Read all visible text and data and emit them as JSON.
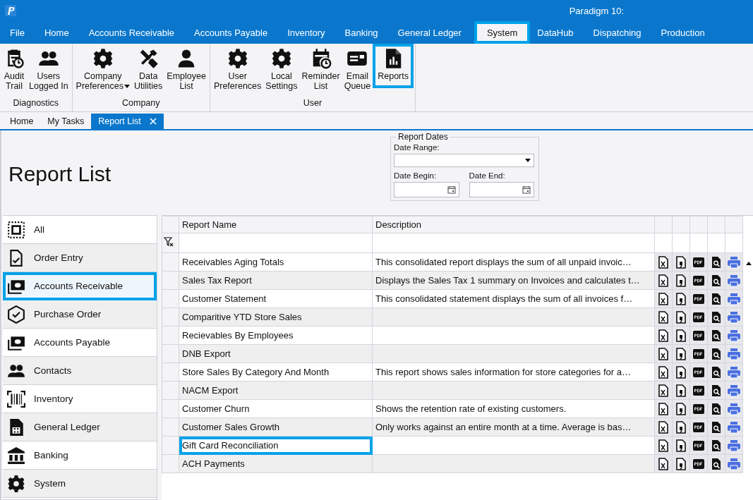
{
  "window": {
    "title": "Paradigm 10:"
  },
  "menu": [
    {
      "label": "File",
      "selected": false
    },
    {
      "label": "Home",
      "selected": false
    },
    {
      "label": "Accounts Receivable",
      "selected": false
    },
    {
      "label": "Accounts Payable",
      "selected": false
    },
    {
      "label": "Inventory",
      "selected": false
    },
    {
      "label": "Banking",
      "selected": false
    },
    {
      "label": "General Ledger",
      "selected": false
    },
    {
      "label": "System",
      "selected": true
    },
    {
      "label": "DataHub",
      "selected": false
    },
    {
      "label": "Dispatching",
      "selected": false
    },
    {
      "label": "Production",
      "selected": false
    }
  ],
  "ribbon": [
    {
      "group": "Diagnostics",
      "buttons": [
        {
          "lines": [
            "Audit",
            "Trail"
          ],
          "highlighted": false
        },
        {
          "lines": [
            "Users",
            "Logged In"
          ],
          "highlighted": false
        }
      ]
    },
    {
      "group": "Company",
      "buttons": [
        {
          "lines": [
            "Company",
            "Preferences"
          ],
          "dropdown": true,
          "highlighted": false
        },
        {
          "lines": [
            "Data",
            "Utilities"
          ],
          "highlighted": false
        },
        {
          "lines": [
            "Employee",
            "List"
          ],
          "highlighted": false
        }
      ]
    },
    {
      "group": "User",
      "buttons": [
        {
          "lines": [
            "User",
            "Preferences"
          ],
          "highlighted": false
        },
        {
          "lines": [
            "Local",
            "Settings"
          ],
          "highlighted": false
        },
        {
          "lines": [
            "Reminder",
            "List"
          ],
          "highlighted": false
        },
        {
          "lines": [
            "Email",
            "Queue"
          ],
          "highlighted": false
        },
        {
          "lines": [
            "Reports"
          ],
          "highlighted": true
        }
      ]
    }
  ],
  "doc_tabs": [
    {
      "label": "Home",
      "selected": false
    },
    {
      "label": "My Tasks",
      "selected": false
    },
    {
      "label": "Report List",
      "selected": true
    }
  ],
  "page_title": "Report List",
  "report_dates": {
    "title": "Report Dates",
    "range_label": "Date Range:",
    "begin_label": "Date Begin:",
    "end_label": "Date End:"
  },
  "sidebar": [
    {
      "label": "All",
      "selected": false
    },
    {
      "label": "Order Entry",
      "selected": false
    },
    {
      "label": "Accounts Receivable",
      "selected": true
    },
    {
      "label": "Purchase Order",
      "selected": false
    },
    {
      "label": "Accounts Payable",
      "selected": false
    },
    {
      "label": "Contacts",
      "selected": false
    },
    {
      "label": "Inventory",
      "selected": false
    },
    {
      "label": "General Ledger",
      "selected": false
    },
    {
      "label": "Banking",
      "selected": false
    },
    {
      "label": "System",
      "selected": false
    }
  ],
  "table": {
    "columns": [
      "Report Name",
      "Description"
    ],
    "rows": [
      {
        "name": "Receivables Aging Totals",
        "description": "This consolidated report displays the sum of all unpaid invoic…",
        "highlighted": false
      },
      {
        "name": "Sales Tax Report",
        "description": "Displays the Sales Tax 1 summary on Invoices and calculates t…",
        "highlighted": false
      },
      {
        "name": "Customer Statement",
        "description": "This consolidated statement displays the sum of all invoices f…",
        "highlighted": false
      },
      {
        "name": "Comparitive YTD Store Sales",
        "highlighted": false
      },
      {
        "name": "Recievables By  Employees",
        "highlighted": false
      },
      {
        "name": "DNB Export",
        "highlighted": false
      },
      {
        "name": "Store Sales By Category And Month",
        "description": "This report shows sales information for store categories for a…",
        "highlighted": false
      },
      {
        "name": "NACM Export",
        "highlighted": false
      },
      {
        "name": "Customer Churn",
        "description": "Shows the retention rate of existing customers.",
        "highlighted": false
      },
      {
        "name": "Customer Sales Growth",
        "description": "Only works against an entire month at a time. Average is bas…",
        "highlighted": false
      },
      {
        "name": "Gift Card Reconciliation",
        "highlighted": true
      },
      {
        "name": "ACH Payments",
        "highlighted": false
      }
    ]
  }
}
